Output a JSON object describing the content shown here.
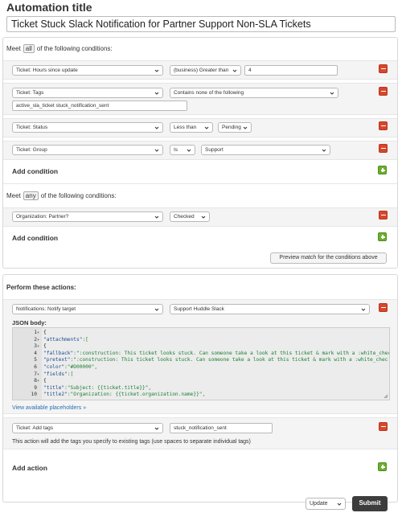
{
  "automation": {
    "title_label": "Automation title",
    "title_value": "Ticket Stuck Slack Notification for Partner Support Non-SLA Tickets"
  },
  "all_conditions": {
    "meet_prefix": "Meet",
    "meet_select": "all",
    "meet_suffix": "of the following conditions:",
    "rows": [
      {
        "field": "Ticket: Hours since update",
        "operator": "(business) Greater than",
        "value": "4"
      },
      {
        "field": "Ticket: Tags",
        "operator": "Contains none of the following",
        "value": "active_sla_ticket stuck_notification_sent"
      },
      {
        "field": "Ticket: Status",
        "operator": "Less than",
        "value": "Pending"
      },
      {
        "field": "Ticket: Group",
        "operator": "Is",
        "value": "Support"
      }
    ],
    "add_label": "Add condition"
  },
  "any_conditions": {
    "meet_prefix": "Meet",
    "meet_select": "any",
    "meet_suffix": "of the following conditions:",
    "rows": [
      {
        "field": "Organization: Partner?",
        "operator": "Checked"
      }
    ],
    "add_label": "Add condition"
  },
  "preview_button": "Preview match for the conditions above",
  "actions": {
    "header": "Perform these actions:",
    "notify": {
      "field": "Notifications: Notify target",
      "target": "Support Huddle Slack"
    },
    "json_label": "JSON body:",
    "code_lines": [
      {
        "n": "1",
        "fold": "▾",
        "text": "{"
      },
      {
        "n": "2",
        "fold": "▾",
        "key": "\"attachments\"",
        "rest": ":["
      },
      {
        "n": "3",
        "fold": "▾",
        "text": "{"
      },
      {
        "n": "4",
        "fold": "",
        "key": "\"fallback\"",
        "rest": ":\":construction: This ticket looks stuck. Can someone take a look at this ticket & mark with a :white_chec"
      },
      {
        "n": "5",
        "fold": "",
        "key": "\"pretext\"",
        "rest": ":\":construction: This ticket looks stuck. Can someone take a look at this ticket & mark with a :white_chec"
      },
      {
        "n": "6",
        "fold": "",
        "key": "\"color\"",
        "rest": ":\"#D00000\","
      },
      {
        "n": "7",
        "fold": "▾",
        "key": "\"fields\"",
        "rest": ":["
      },
      {
        "n": "8",
        "fold": "▾",
        "text": "{"
      },
      {
        "n": "9",
        "fold": "",
        "key": "\"title\"",
        "rest": ":\"Subject: {{ticket.title}}\","
      },
      {
        "n": "10",
        "fold": "",
        "key": "\"title2\"",
        "rest": ":\"Organization: {{ticket.organization.name}}\","
      }
    ],
    "placeholders_link": "View available placeholders »",
    "tags": {
      "field": "Ticket: Add tags",
      "value": "stuck_notification_sent"
    },
    "tags_note": "This action will add the tags you specify to existing tags (use spaces to separate individual tags)",
    "add_label": "Add action"
  },
  "footer": {
    "select_value": "Update",
    "submit_label": "Submit"
  },
  "colors": {
    "remove": "#d9462b",
    "add": "#6cae2e",
    "submit_bg": "#3d3d3d",
    "link": "#2a6fb0"
  }
}
